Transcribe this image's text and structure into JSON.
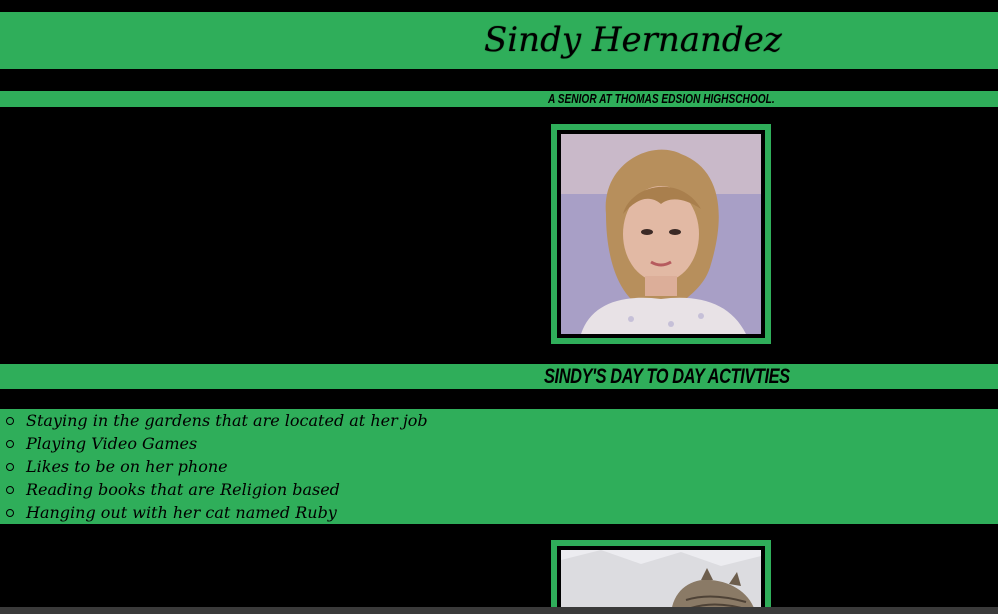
{
  "header": {
    "title": "Sindy Hernandez",
    "subtitle": "A senior at Thomas Edsion Highschool."
  },
  "section": {
    "title": "Sindy's Day to Day Activties"
  },
  "activities": [
    "Staying in the gardens that are located at her job",
    "Playing Video Games",
    "Likes to be on her phone",
    "Reading books that are Religion based",
    "Hanging out with her cat named Ruby"
  ],
  "colors": {
    "background": "#000000",
    "accent": "#2fae5a",
    "text": "#000000"
  },
  "icons": {
    "bullet": "hollow-circle-bullet-icon"
  }
}
